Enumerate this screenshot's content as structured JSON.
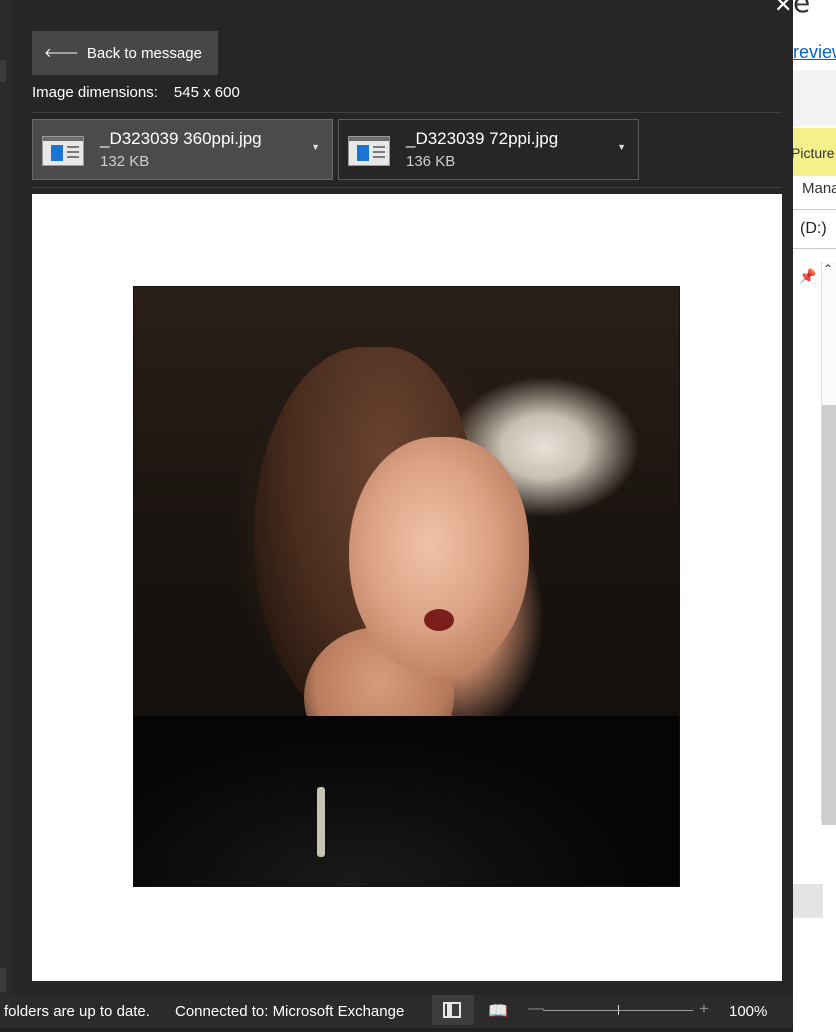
{
  "viewer": {
    "back_label": "Back to message",
    "dimensions_label": "Image dimensions:",
    "dimensions_value": "545 x 600",
    "attachments": [
      {
        "name": "_D323039 360ppi.jpg",
        "size": "132 KB",
        "selected": true
      },
      {
        "name": "_D323039 72ppi.jpg",
        "size": "136 KB",
        "selected": false
      }
    ]
  },
  "background_window": {
    "link_text": "review",
    "picture_text": "Picture",
    "mana_text": "Mana",
    "drive_text": "(D:)"
  },
  "status_bar": {
    "sync_text": "folders are up to date.",
    "connection_text": "Connected to: Microsoft Exchange",
    "zoom": "100%",
    "zoom_level": 0.5
  },
  "icons": {
    "back": "arrow-left-icon",
    "close": "close-icon",
    "attachment": "image-file-icon",
    "dropdown": "chevron-down-icon",
    "normal_view": "normal-view-icon",
    "reading_view": "reading-view-icon",
    "pin": "pin-icon"
  },
  "colors": {
    "panel_bg": "#262626",
    "accent_blue": "#1a75d2",
    "highlight_yellow": "#f4f08a"
  }
}
